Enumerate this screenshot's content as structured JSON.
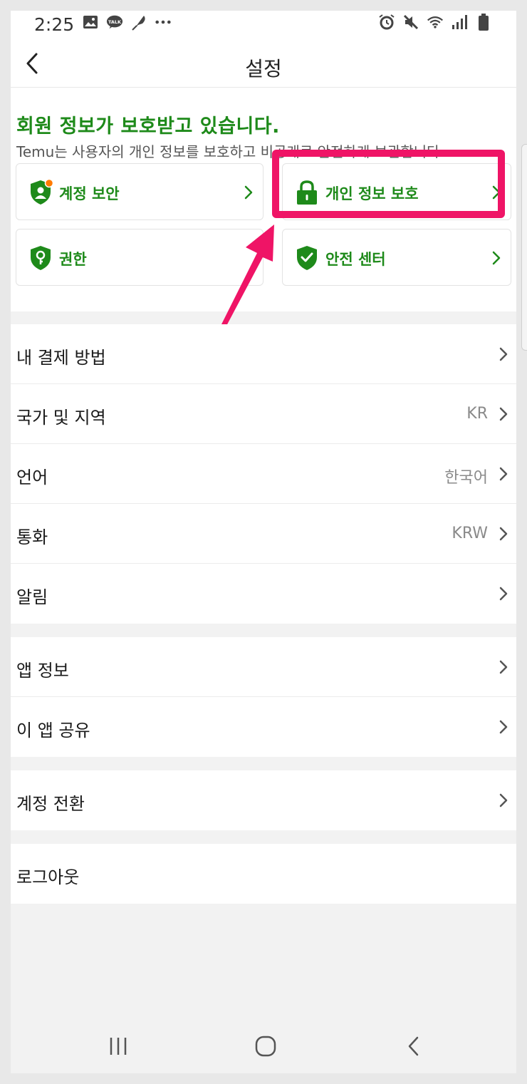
{
  "status_bar": {
    "time": "2:25",
    "left_icons": [
      "gallery-icon",
      "kakaotalk-icon",
      "feather-icon",
      "more-dots-icon"
    ],
    "right_icons": [
      "alarm-icon",
      "mute-icon",
      "wifi-icon",
      "signal-icon",
      "battery-icon"
    ]
  },
  "header": {
    "title": "설정"
  },
  "protection": {
    "title": "회원 정보가 보호받고 있습니다.",
    "subtitle": "Temu는 사용자의 개인 정보를 보호하고 비공개로 안전하게 보관합니다.",
    "cards": [
      {
        "label": "계정 보안",
        "icon": "account-security-icon",
        "badge": true
      },
      {
        "label": "개인 정보 보호",
        "icon": "lock-icon",
        "highlighted": true
      },
      {
        "label": "권한",
        "icon": "key-shield-icon"
      },
      {
        "label": "안전 센터",
        "icon": "check-shield-icon"
      }
    ]
  },
  "settings_groups": [
    {
      "rows": [
        {
          "label": "내 결제 방법",
          "value": ""
        },
        {
          "label": "국가 및 지역",
          "value": "KR"
        },
        {
          "label": "언어",
          "value": "한국어"
        },
        {
          "label": "통화",
          "value": "KRW"
        },
        {
          "label": "알림",
          "value": ""
        }
      ]
    },
    {
      "rows": [
        {
          "label": "앱 정보",
          "value": ""
        },
        {
          "label": "이 앱 공유",
          "value": ""
        }
      ]
    },
    {
      "rows": [
        {
          "label": "계정 전환",
          "value": ""
        }
      ]
    },
    {
      "rows": [
        {
          "label": "로그아웃",
          "value": ""
        }
      ]
    }
  ],
  "colors": {
    "brand_green": "#1e8a1a",
    "highlight": "#ef1466",
    "badge_orange": "#ff7a00"
  }
}
